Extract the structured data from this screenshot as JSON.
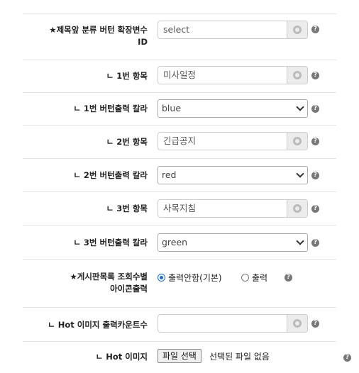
{
  "fields": [
    {
      "label_line1": "★제목앞 분류 버턴 확장변수",
      "label_line2": "ID",
      "type": "text",
      "value": "select"
    },
    {
      "label": "ㄴ 1번 항목",
      "type": "text",
      "value": "미사일정"
    },
    {
      "label": "ㄴ 1번 버턴출력 칼라",
      "type": "select",
      "value": "blue"
    },
    {
      "label": "ㄴ 2번 항목",
      "type": "text",
      "value": "긴급공지"
    },
    {
      "label": "ㄴ 2번 버턴출력 칼라",
      "type": "select",
      "value": "red"
    },
    {
      "label": "ㄴ 3번 항목",
      "type": "text",
      "value": "사목지침"
    },
    {
      "label": "ㄴ 3번 버턴출력 칼라",
      "type": "select",
      "value": "green"
    },
    {
      "label_line1": "★게시판목록 조회수별",
      "label_line2": "아이콘출력",
      "type": "radio",
      "options": [
        "출력안함(기본)",
        "출력"
      ],
      "selected": "출력안함(기본)"
    },
    {
      "label": "ㄴ Hot 이미지 출력카운트수",
      "type": "text",
      "value": ""
    },
    {
      "label": "ㄴ Hot 이미지",
      "type": "file",
      "button_label": "파일 선택",
      "status": "선택된 파일 없음"
    }
  ],
  "help_glyph": "?",
  "colors": {
    "accent": "#1a6fd6",
    "help": "#777777"
  }
}
